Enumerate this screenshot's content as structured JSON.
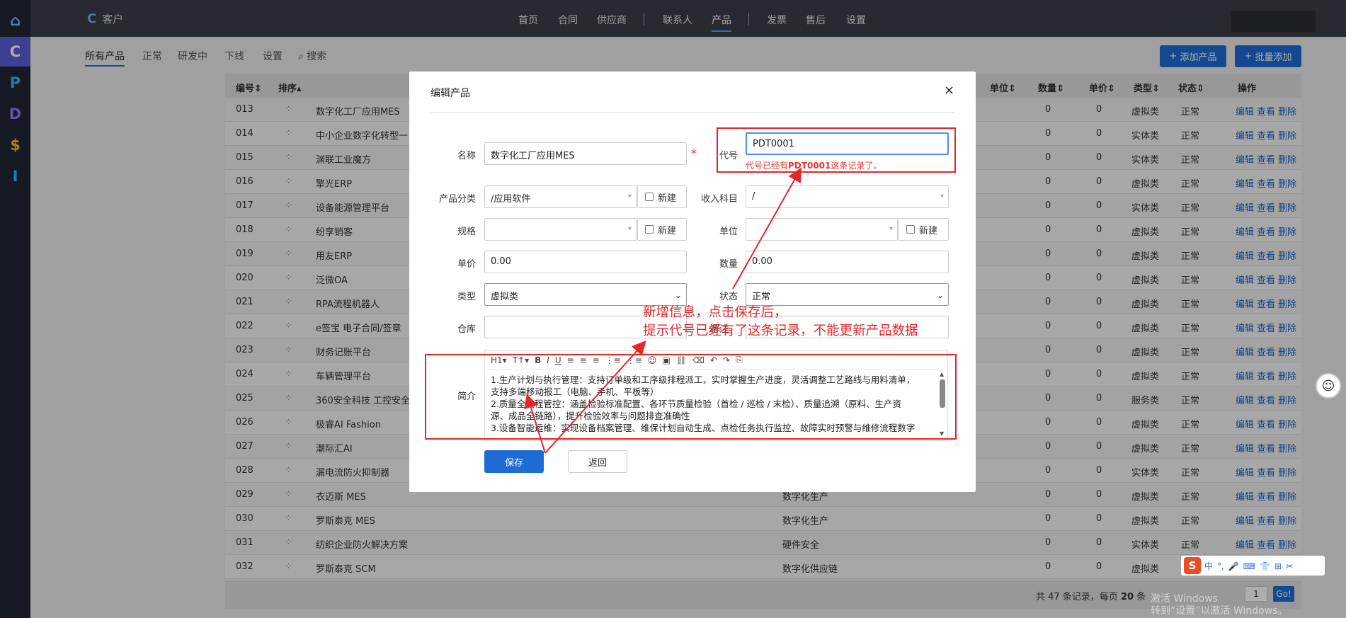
{
  "sidebar": {
    "items": [
      {
        "label": "⌂",
        "name": "home-icon",
        "color": "#7eb8ff",
        "bg": "#1f2636"
      },
      {
        "label": "C",
        "name": "sidebar-item-c",
        "color": "#ffffff",
        "bg": "#5b5fd6"
      },
      {
        "label": "P",
        "name": "sidebar-item-p",
        "color": "#3fb3f5",
        "bg": "#1f2636"
      },
      {
        "label": "D",
        "name": "sidebar-item-d",
        "color": "#8c7cf5",
        "bg": "#1f2636"
      },
      {
        "label": "$",
        "name": "sidebar-item-dollar",
        "color": "#f5c22a",
        "bg": "#1f2636"
      },
      {
        "label": "I",
        "name": "sidebar-item-i",
        "color": "#3fb3f5",
        "bg": "#1f2636"
      }
    ]
  },
  "header": {
    "brand": "客户",
    "nav": [
      "首页",
      "合同",
      "供应商",
      "联系人",
      "产品",
      "发票",
      "售后",
      "设置"
    ],
    "active": "产品",
    "search_icon": "⌕"
  },
  "subtabs": {
    "items": [
      "所有产品",
      "正常",
      "研发中",
      "下线",
      "设置"
    ],
    "search": "搜索",
    "add_product": "添加产品",
    "batch_add": "批量添加"
  },
  "table": {
    "headers": {
      "id": "编号",
      "sort": "排序",
      "unit": "单位",
      "qty": "数量",
      "price": "单价",
      "type": "类型",
      "status": "状态",
      "ops": "操作"
    },
    "ops": {
      "edit": "编辑",
      "view": "查看",
      "del": "删除"
    },
    "rows": [
      {
        "id": "013",
        "name": "数字化工厂应用MES",
        "cat": "",
        "qty": "0",
        "price": "0",
        "type": "虚拟类",
        "status": "正常"
      },
      {
        "id": "014",
        "name": "中小企业数字化转型一",
        "cat": "",
        "qty": "0",
        "price": "0",
        "type": "实体类",
        "status": "正常"
      },
      {
        "id": "015",
        "name": "渊联工业魔方",
        "cat": "",
        "qty": "0",
        "price": "0",
        "type": "实体类",
        "status": "正常"
      },
      {
        "id": "016",
        "name": "擎光ERP",
        "cat": "",
        "qty": "0",
        "price": "0",
        "type": "虚拟类",
        "status": "正常"
      },
      {
        "id": "017",
        "name": "设备能源管理平台",
        "cat": "",
        "qty": "0",
        "price": "0",
        "type": "实体类",
        "status": "正常"
      },
      {
        "id": "018",
        "name": "纷享销客",
        "cat": "",
        "qty": "0",
        "price": "0",
        "type": "虚拟类",
        "status": "正常"
      },
      {
        "id": "019",
        "name": "用友ERP",
        "cat": "",
        "qty": "0",
        "price": "0",
        "type": "虚拟类",
        "status": "正常"
      },
      {
        "id": "020",
        "name": "泛微OA",
        "cat": "",
        "qty": "0",
        "price": "0",
        "type": "虚拟类",
        "status": "正常"
      },
      {
        "id": "021",
        "name": "RPA流程机器人",
        "cat": "",
        "qty": "0",
        "price": "0",
        "type": "虚拟类",
        "status": "正常"
      },
      {
        "id": "022",
        "name": "e签宝 电子合同/签章",
        "cat": "",
        "qty": "0",
        "price": "0",
        "type": "虚拟类",
        "status": "正常"
      },
      {
        "id": "023",
        "name": "财务记账平台",
        "cat": "",
        "qty": "0",
        "price": "0",
        "type": "虚拟类",
        "status": "正常"
      },
      {
        "id": "024",
        "name": "车辆管理平台",
        "cat": "",
        "qty": "0",
        "price": "0",
        "type": "虚拟类",
        "status": "正常"
      },
      {
        "id": "025",
        "name": "360安全科技 工控安全",
        "cat": "",
        "qty": "0",
        "price": "0",
        "type": "服务类",
        "status": "正常"
      },
      {
        "id": "026",
        "name": "极睿AI Fashion",
        "cat": "",
        "qty": "0",
        "price": "0",
        "type": "虚拟类",
        "status": "正常"
      },
      {
        "id": "027",
        "name": "潮际汇AI",
        "cat": "",
        "qty": "0",
        "price": "0",
        "type": "虚拟类",
        "status": "正常"
      },
      {
        "id": "028",
        "name": "漏电流防火抑制器",
        "cat": "",
        "qty": "0",
        "price": "0",
        "type": "实体类",
        "status": "正常"
      },
      {
        "id": "029",
        "name": "衣迈斯 MES",
        "cat": "数字化生产",
        "qty": "0",
        "price": "0",
        "type": "虚拟类",
        "status": "正常"
      },
      {
        "id": "030",
        "name": "罗斯泰克 MES",
        "cat": "数字化生产",
        "qty": "0",
        "price": "0",
        "type": "虚拟类",
        "status": "正常"
      },
      {
        "id": "031",
        "name": "纺织企业防火解决方案",
        "cat": "硬件安全",
        "qty": "0",
        "price": "0",
        "type": "实体类",
        "status": "正常"
      },
      {
        "id": "032",
        "name": "罗斯泰克 SCM",
        "cat": "数字化供应链",
        "qty": "0",
        "price": "0",
        "type": "虚拟类",
        "status": "正常"
      }
    ],
    "footer": {
      "total": "共 47 条记录，每页",
      "per_page": "20",
      "per_unit": "条",
      "page": "1",
      "go": "Go!"
    }
  },
  "dialog": {
    "title": "编辑产品",
    "close": "×",
    "fields": {
      "name_label": "名称",
      "name_value": "数字化工厂应用MES",
      "required_mark": "*",
      "code_label": "代号",
      "code_value": "PDT0001",
      "code_error_prefix": "代号已经有",
      "code_error_code": "PDT0001",
      "code_error_suffix": "这条记录了。",
      "category_label": "产品分类",
      "category_value": "/应用软件",
      "new_label": "新建",
      "income_label": "收入科目",
      "income_value": "/",
      "spec_label": "规格",
      "unit_label": "单位",
      "price_label": "单价",
      "price_value": "0.00",
      "qty_label": "数量",
      "qty_value": "0.00",
      "type_label": "类型",
      "type_value": "虚拟类",
      "status_label": "状态",
      "status_value": "正常",
      "warehouse_label": "仓库",
      "remark_label": "备注",
      "intro_label": "简介"
    },
    "editor": {
      "toolbar": [
        "H1▾",
        "T↑▾",
        "B",
        "I",
        "U",
        "≡",
        "≡",
        "≡",
        "⋮≡",
        "⋮≡",
        "☺",
        "▣",
        "⛓",
        "⌫",
        "↶",
        "↷",
        "⎘"
      ],
      "lines": [
        "1.生产计划与执行管理：支持订单级和工序级排程派工，实时掌握生产进度，灵活调整工艺路线与用料清单，",
        "支持多端移动报工（电脑、手机、平板等）",
        "2.质量全流程管控：涵盖检验标准配置、各环节质量检验（首检 / 巡检 / 末检）、质量追溯（原料、生产资",
        "源、成品全链路），提升检验效率与问题排查准确性",
        "3.设备智能运维：实现设备档案管理、维保计划自动生成、点检任务执行监控、故障实时预警与维修流程数字"
      ]
    },
    "save": "保存",
    "back": "返回"
  },
  "annotation": {
    "line1": "新增信息，点击保存后，",
    "line2": "提示代号已经有了这条记录，不能更新产品数据",
    "color": "#e3262a"
  },
  "ime": {
    "logo": "S",
    "items": [
      "中",
      "°,",
      "🎤",
      "⌨",
      "👕",
      "⊞",
      "✂"
    ]
  },
  "watermark": {
    "line1": "激活 Windows",
    "line2": "转到“设置”以激活 Windows。"
  }
}
